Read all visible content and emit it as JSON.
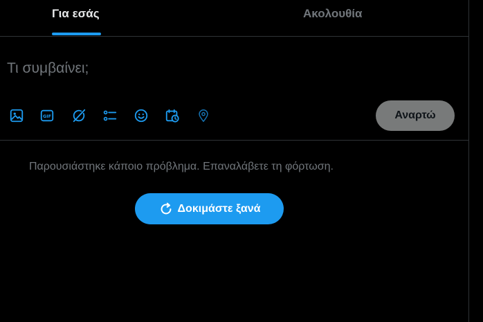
{
  "tabs": {
    "for_you": "Για εσάς",
    "following": "Ακολουθία"
  },
  "composer": {
    "placeholder": "Τι συμβαίνει;",
    "value": "",
    "post_label": "Αναρτώ",
    "tools": [
      {
        "icon": "media-icon"
      },
      {
        "icon": "gif-icon"
      },
      {
        "icon": "grok-icon"
      },
      {
        "icon": "poll-icon"
      },
      {
        "icon": "emoji-icon"
      },
      {
        "icon": "schedule-icon"
      },
      {
        "icon": "location-icon"
      }
    ]
  },
  "feed": {
    "error_message": "Παρουσιάστηκε κάποιο πρόβλημα. Επαναλάβετε τη φόρτωση.",
    "retry_label": "Δοκιμάστε ξανά"
  },
  "colors": {
    "background": "#000000",
    "accent": "#1d9bf0",
    "border": "#2f3336",
    "text_primary": "#e7e9ea",
    "text_secondary": "#71767b",
    "post_button_disabled": "#787a7a"
  }
}
